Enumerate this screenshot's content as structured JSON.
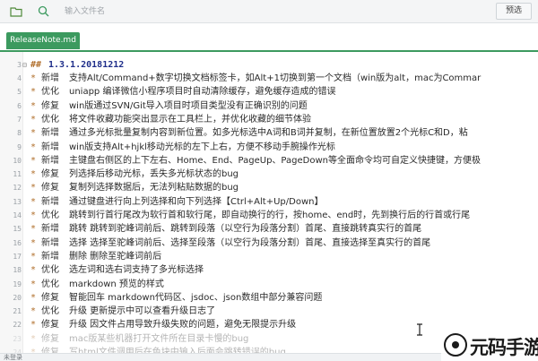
{
  "toolbar": {
    "search_placeholder": "输入文件名",
    "preview_label": "预选"
  },
  "tabs": [
    {
      "label": "ReleaseNote.md",
      "active": true
    }
  ],
  "colors": {
    "accent": "#3c9a5f",
    "heading": "#1f2e8a",
    "bullet": "#b06e2a"
  },
  "editor": {
    "heading": {
      "line": "3",
      "mark": "##",
      "text": "1.3.1.20181212"
    },
    "lines": [
      {
        "line": "4",
        "tag": "新增",
        "text": "支持Alt/Command+数字切换文档标签卡，如Alt+1切换到第一个文档（win版为alt，mac为Commar"
      },
      {
        "line": "5",
        "tag": "优化",
        "text": "uniapp 编译微信小程序项目时自动清除缓存，避免缓存造成的错误"
      },
      {
        "line": "6",
        "tag": "修复",
        "text": "win版通过SVN/Git导入项目时项目类型没有正确识别的问题"
      },
      {
        "line": "7",
        "tag": "优化",
        "text": "将文件收藏功能突出显示在工具栏上，并优化收藏的细节体验"
      },
      {
        "line": "8",
        "tag": "新增",
        "text": "通过多光标批量复制内容到新位置。如多光标选中A词和B词并复制，在新位置放置2个光标C和D，粘"
      },
      {
        "line": "9",
        "tag": "新增",
        "text": "win版支持Alt+hjkl移动光标的左下上右，方便不移动手腕操作光标"
      },
      {
        "line": "10",
        "tag": "新增",
        "text": "主键盘右侧区的上下左右、Home、End、PageUp、PageDown等全面命令均可自定义快捷键，方便极"
      },
      {
        "line": "11",
        "tag": "修复",
        "text": "列选择后移动光标，丢失多光标状态的bug"
      },
      {
        "line": "12",
        "tag": "修复",
        "text": "复制列选择数据后，无法列粘贴数据的bug"
      },
      {
        "line": "13",
        "tag": "新增",
        "text": "通过键盘进行向上列选择和向下列选择【Ctrl+Alt+Up/Down】"
      },
      {
        "line": "14",
        "tag": "优化",
        "text": "跳转到行首行尾改为软行首和软行尾，即自动换行的行，按home、end时，先到换行后的行首或行尾"
      },
      {
        "line": "15",
        "tag": "新增",
        "text": "跳转 跳转到驼峰词前后、跳转到段落（以空行为段落分割）首尾、直接跳转真实行的首尾"
      },
      {
        "line": "16",
        "tag": "新增",
        "text": "选择 选择至驼峰词前后、选择至段落（以空行为段落分割）首尾、直接选择至真实行的首尾"
      },
      {
        "line": "17",
        "tag": "新增",
        "text": "删除 删除至驼峰词前后"
      },
      {
        "line": "18",
        "tag": "优化",
        "text": "选左词和选右词支持了多光标选择"
      },
      {
        "line": "19",
        "tag": "优化",
        "text": "markdown 预览的样式"
      },
      {
        "line": "20",
        "tag": "修复",
        "text": "智能回车 markdown代码区、jsdoc、json数组中部分兼容问题"
      },
      {
        "line": "21",
        "tag": "优化",
        "text": "升级 更新提示中可以查看升级日志了"
      },
      {
        "line": "22",
        "tag": "修复",
        "text": "升级 因文件占用导致升级失败的问题，避免无限提示升级"
      },
      {
        "line": "23",
        "tag": "修复",
        "text": "mac版某些机器打开文件所在目录卡慢的bug"
      },
      {
        "line": "24",
        "tag": "修复",
        "text": "写html文件调用后在色块中输入后面会跳转错误的bug"
      }
    ]
  },
  "status": {
    "text": "未登录"
  },
  "watermark": {
    "text": "元码手游网"
  }
}
